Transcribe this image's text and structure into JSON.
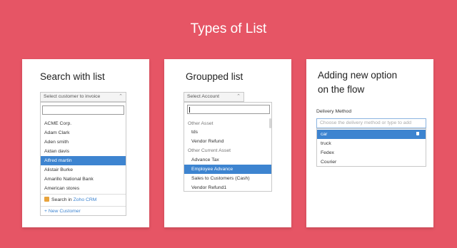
{
  "page": {
    "title": "Types of List"
  },
  "card1": {
    "title": "Search with list",
    "select_placeholder": "Select customer to invoice",
    "options": [
      {
        "label": "ACME Corp.",
        "selected": false
      },
      {
        "label": "Adam Clark",
        "selected": false
      },
      {
        "label": "Aden smith",
        "selected": false
      },
      {
        "label": "Aidan davis",
        "selected": false
      },
      {
        "label": "Alfred martin",
        "selected": true
      },
      {
        "label": "Alistair Burke",
        "selected": false
      },
      {
        "label": "Amarillo National Bank",
        "selected": false
      },
      {
        "label": "American stores",
        "selected": false
      }
    ],
    "search_in_prefix": "Search in",
    "search_in_link": "Zoho CRM",
    "new_customer": "+ New Customer"
  },
  "card2": {
    "title": "Groupped list",
    "select_placeholder": "Select Account",
    "rows": [
      {
        "label": "Other Asset",
        "group": true,
        "selected": false
      },
      {
        "label": "tds",
        "group": false,
        "selected": false
      },
      {
        "label": "Vendor Refund",
        "group": false,
        "selected": false
      },
      {
        "label": "Other Current Asset",
        "group": true,
        "selected": false
      },
      {
        "label": "Advance Tax",
        "group": false,
        "selected": false
      },
      {
        "label": "Employee Advance",
        "group": false,
        "selected": true
      },
      {
        "label": "Sales to Customers (Cash)",
        "group": false,
        "selected": false
      },
      {
        "label": "Vendor Refund1",
        "group": false,
        "selected": false
      }
    ]
  },
  "card3": {
    "title_line1": "Adding new option",
    "title_line2": "on the flow",
    "field_label": "Delivery Method",
    "input_placeholder": "Choose the delivery method or type to add",
    "options": [
      {
        "label": "car",
        "selected": true
      },
      {
        "label": "truck",
        "selected": false
      },
      {
        "label": "Fedex",
        "selected": false
      },
      {
        "label": "Courier",
        "selected": false
      }
    ]
  }
}
